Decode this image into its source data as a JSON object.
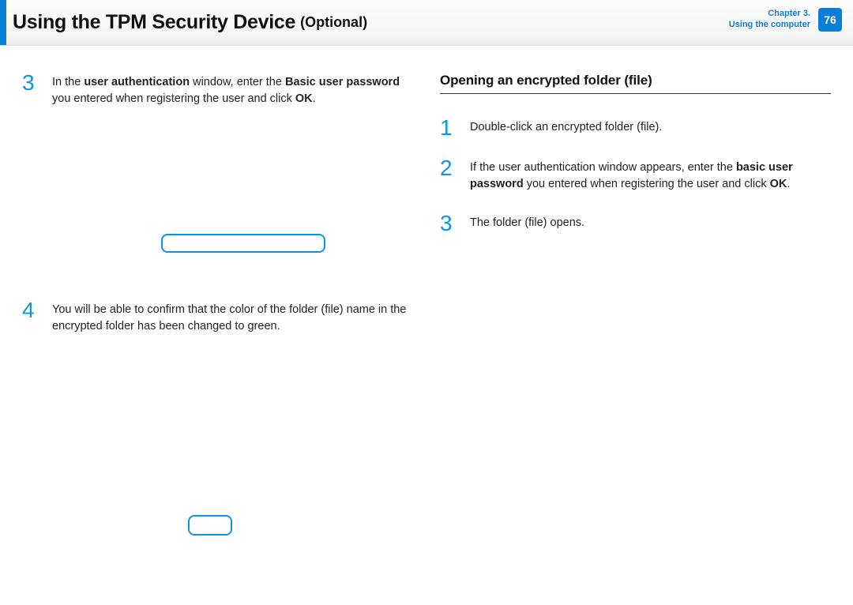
{
  "header": {
    "title": "Using the TPM Security Device",
    "suffix": "(Optional)",
    "chapter_line1": "Chapter 3.",
    "chapter_line2": "Using the computer",
    "page_number": "76"
  },
  "left": {
    "step3": {
      "num": "3",
      "t1": "In the ",
      "t2": "user authentication",
      "t3": " window, enter the ",
      "t4": "Basic user password",
      "t5": " you entered when registering the user and click ",
      "t6": "OK",
      "t7": "."
    },
    "step4": {
      "num": "4",
      "text": "You will be able to confirm that the color of the folder (file) name in the encrypted folder has been changed to green."
    }
  },
  "right": {
    "subheading": "Opening an encrypted folder (file)",
    "step1": {
      "num": "1",
      "text": "Double-click an encrypted folder (file)."
    },
    "step2": {
      "num": "2",
      "t1": "If the user authentication window appears, enter the ",
      "t2": "basic user password",
      "t3": " you entered when registering the user and click ",
      "t4": "OK",
      "t5": "."
    },
    "step3": {
      "num": "3",
      "text": "The folder (file) opens."
    }
  }
}
